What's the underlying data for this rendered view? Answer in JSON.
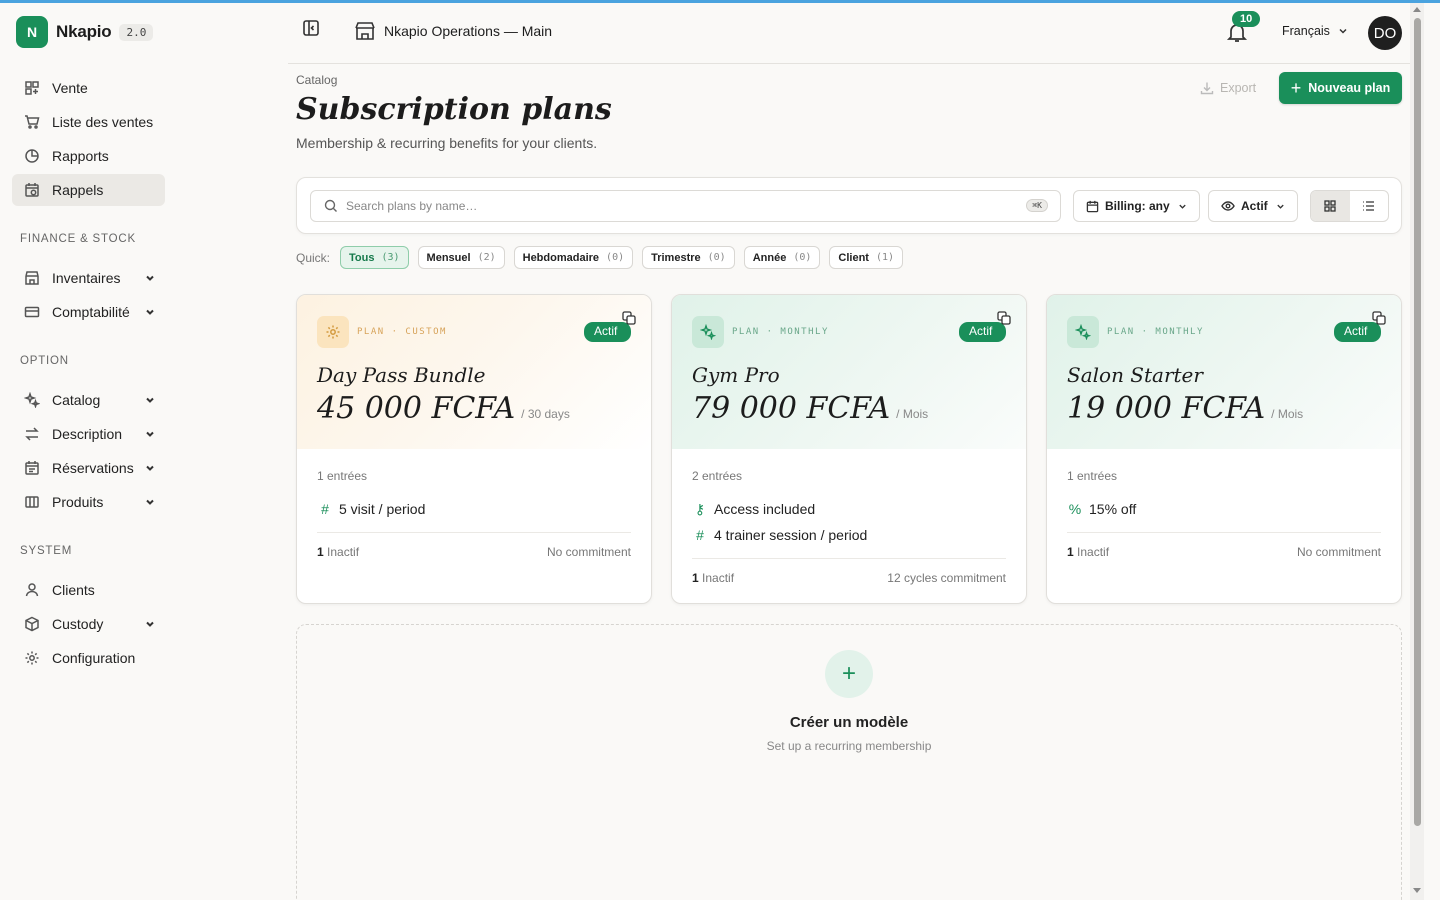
{
  "app": {
    "name": "Nkapio",
    "version": "2.0",
    "logo_letter": "N",
    "accent": "#1a8f5a"
  },
  "sidebar": {
    "main": [
      {
        "label": "Vente",
        "icon": "grid-plus-icon"
      },
      {
        "label": "Liste des ventes",
        "icon": "cart-icon"
      },
      {
        "label": "Rapports",
        "icon": "pie-chart-icon"
      },
      {
        "label": "Rappels",
        "icon": "calendar-clock-icon",
        "active": true
      }
    ],
    "finance_title": "FINANCE & STOCK",
    "finance": [
      {
        "label": "Inventaires",
        "icon": "store-icon"
      },
      {
        "label": "Comptabilité",
        "icon": "card-icon"
      }
    ],
    "option_title": "OPTION",
    "option": [
      {
        "label": "Catalog",
        "icon": "sparkles-icon"
      },
      {
        "label": "Description",
        "icon": "arrows-icon"
      },
      {
        "label": "Réservations",
        "icon": "calendar-icon"
      },
      {
        "label": "Produits",
        "icon": "box-icon"
      }
    ],
    "system_title": "SYSTEM",
    "system": [
      {
        "label": "Clients",
        "icon": "user-icon"
      },
      {
        "label": "Custody",
        "icon": "package-icon"
      },
      {
        "label": "Configuration",
        "icon": "gear-icon"
      }
    ]
  },
  "header": {
    "store": "Nkapio Operations — Main",
    "notifications": "10",
    "language": "Français",
    "avatar": "DO"
  },
  "page": {
    "breadcrumb": "Catalog",
    "title": "Subscription plans",
    "subtitle": "Membership & recurring benefits for your clients.",
    "export_label": "Export",
    "new_label": "Nouveau plan"
  },
  "filters": {
    "search_placeholder": "Search plans by name…",
    "search_shortcut": "⌘K",
    "billing": "Billing: any",
    "status": "Actif",
    "quick_label": "Quick:",
    "chips": [
      {
        "label": "Tous",
        "count": "(3)",
        "active": true
      },
      {
        "label": "Mensuel",
        "count": "(2)"
      },
      {
        "label": "Hebdomadaire",
        "count": "(0)"
      },
      {
        "label": "Trimestre",
        "count": "(0)"
      },
      {
        "label": "Année",
        "count": "(0)"
      },
      {
        "label": "Client",
        "count": "(1)"
      }
    ]
  },
  "plans": [
    {
      "kind": "PLAN · CUSTOM",
      "status": "Actif",
      "name": "Day Pass Bundle",
      "price": "45 000 FCFA",
      "period": "/ 30 days",
      "entries": "1 entrées",
      "benefits": [
        {
          "icon": "#",
          "text": "5 visit / period"
        }
      ],
      "inactive_count": "1",
      "inactive_label": "Inactif",
      "commitment": "No commitment",
      "theme": "warm",
      "icon": "gear-icon"
    },
    {
      "kind": "PLAN · MONTHLY",
      "status": "Actif",
      "name": "Gym Pro",
      "price": "79 000 FCFA",
      "period": "/ Mois",
      "entries": "2 entrées",
      "benefits": [
        {
          "icon": "⚷",
          "text": "Access included"
        },
        {
          "icon": "#",
          "text": "4 trainer session / period"
        }
      ],
      "inactive_count": "1",
      "inactive_label": "Inactif",
      "commitment": "12 cycles commitment",
      "theme": "cool",
      "icon": "sparkles-icon"
    },
    {
      "kind": "PLAN · MONTHLY",
      "status": "Actif",
      "name": "Salon Starter",
      "price": "19 000 FCFA",
      "period": "/ Mois",
      "entries": "1 entrées",
      "benefits": [
        {
          "icon": "%",
          "text": "15% off"
        }
      ],
      "inactive_count": "1",
      "inactive_label": "Inactif",
      "commitment": "No commitment",
      "theme": "cool",
      "icon": "sparkles-icon"
    }
  ],
  "create": {
    "title": "Créer un modèle",
    "subtitle": "Set up a recurring membership"
  }
}
